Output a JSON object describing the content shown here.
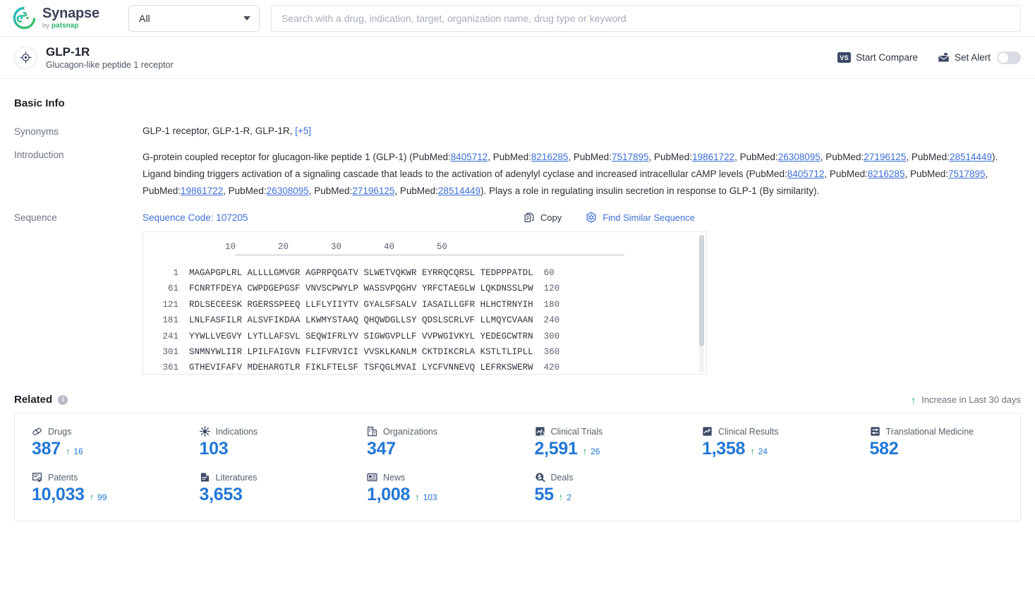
{
  "topbar": {
    "logo_name": "Synapse",
    "logo_by": "by",
    "logo_brand": "patsnap",
    "scope_select": "All",
    "search_placeholder": "Search with a drug, indication, target, organization name, drug type or keyword"
  },
  "entity": {
    "name": "GLP-1R",
    "subtitle": "Glucagon-like peptide 1 receptor",
    "start_compare": "Start Compare",
    "vs_badge": "VS",
    "set_alert": "Set Alert"
  },
  "basic_info": {
    "title": "Basic Info",
    "synonyms_label": "Synonyms",
    "synonyms_value": "GLP-1 receptor,  GLP-1-R,  GLP-1R,",
    "synonyms_more": "[+5]",
    "introduction_label": "Introduction",
    "introduction_parts": {
      "p1": "G-protein coupled receptor for glucagon-like peptide 1 (GLP-1) (PubMed:",
      "p2": ", PubMed:",
      "p3": "). Ligand binding triggers activation of a signaling cascade that leads to the activation of adenylyl cyclase and increased intracellular cAMP levels (PubMed:",
      "p4": "). Plays a role in regulating insulin secretion in response to GLP-1 (By similarity).",
      "refs1": [
        "8405712",
        "8216285",
        "7517895",
        "19861722",
        "26308095",
        "27196125",
        "28514449"
      ],
      "refs2": [
        "8405712",
        "8216285",
        "7517895",
        "19861722",
        "26308095",
        "27196125",
        "28514449"
      ]
    },
    "sequence_label": "Sequence",
    "sequence_code": "Sequence Code: 107205",
    "copy_label": "Copy",
    "find_similar_label": "Find Similar Sequence"
  },
  "sequence_viewer": {
    "ruler": "        10        20        30        40        50",
    "rows": [
      {
        "start": "1",
        "blocks": "MAGAPGPLRL ALLLLGMVGR AGPRPQGATV SLWETVQKWR EYRRQCQRSL TEDPPPATDL",
        "end": "60"
      },
      {
        "start": "61",
        "blocks": "FCNRTFDEYA CWPDGEPGSF VNVSCPWYLP WASSVPQGHV YRFCTAEGLW LQKDNSSLPW",
        "end": "120"
      },
      {
        "start": "121",
        "blocks": "RDLSECEESK RGERSSPEEQ LLFLYIIYTV GYALSFSALV IASAILLGFR HLHCTRNYIH",
        "end": "180"
      },
      {
        "start": "181",
        "blocks": "LNLFASFILR ALSVFIKDAA LKWMYSTAAQ QHQWDGLLSY QDSLSCRLVF LLMQYCVAAN",
        "end": "240"
      },
      {
        "start": "241",
        "blocks": "YYWLLVEGVY LYTLLAFSVL SEQWIFRLYV SIGWGVPLLF VVPWGIVKYL YEDEGCWTRN",
        "end": "300"
      },
      {
        "start": "301",
        "blocks": "SNMNYWLIIR LPILFAIGVN FLIFVRVICI VVSKLKANLM CKTDIKCRLA KSTLTLIPLL",
        "end": "360"
      },
      {
        "start": "361",
        "blocks": "GTHEVIFAFV MDEHARGTLR FIKLFTELSF TSFQGLMVAI LYCFVNNEVQ LEFRKSWERW",
        "end": "420"
      }
    ]
  },
  "related": {
    "title": "Related",
    "increase_note": "Increase in Last 30 days",
    "stats": [
      {
        "icon": "pill-icon",
        "label": "Drugs",
        "value": "387",
        "delta": "16"
      },
      {
        "icon": "virus-icon",
        "label": "Indications",
        "value": "103",
        "delta": ""
      },
      {
        "icon": "organization-icon",
        "label": "Organizations",
        "value": "347",
        "delta": ""
      },
      {
        "icon": "clinical-trial-icon",
        "label": "Clinical Trials",
        "value": "2,591",
        "delta": "26"
      },
      {
        "icon": "clinical-result-icon",
        "label": "Clinical Results",
        "value": "1,358",
        "delta": "24"
      },
      {
        "icon": "translational-medicine-icon",
        "label": "Translational Medicine",
        "value": "582",
        "delta": ""
      },
      {
        "icon": "patent-icon",
        "label": "Patents",
        "value": "10,033",
        "delta": "99"
      },
      {
        "icon": "literature-icon",
        "label": "Literatures",
        "value": "3,653",
        "delta": ""
      },
      {
        "icon": "news-icon",
        "label": "News",
        "value": "1,008",
        "delta": "103"
      },
      {
        "icon": "deal-icon",
        "label": "Deals",
        "value": "55",
        "delta": "2"
      }
    ]
  },
  "colors": {
    "accent_blue": "#2277d6",
    "link_blue": "#3d6fd6",
    "increase_green": "#22a65a",
    "brand_green": "#2bb673"
  }
}
